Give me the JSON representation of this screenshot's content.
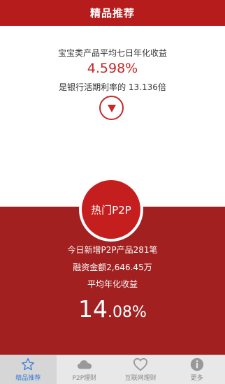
{
  "header": {
    "title": "精品推荐"
  },
  "baobao": {
    "label": "宝宝类产品平均七日年化收益",
    "rate": "4.598%",
    "compare": "是银行活期利率的 13.136倍"
  },
  "hot_p2p": {
    "badge": "热门P2P",
    "new_products": "今日新增P2P产品281笔",
    "financing": "融资金额2,646.45万",
    "avg_label": "平均年化收益",
    "rate_big": "14",
    "rate_small": ".08%"
  },
  "tabs": [
    {
      "label": "精品推荐",
      "icon": "star-icon",
      "active": true
    },
    {
      "label": "P2P理财",
      "icon": "cloud-icon",
      "active": false
    },
    {
      "label": "互联网理财",
      "icon": "heart-icon",
      "active": false
    },
    {
      "label": "更多",
      "icon": "info-icon",
      "active": false
    }
  ],
  "colors": {
    "header_red": "#b71c1c",
    "section_red": "#a32020",
    "accent_red": "#c62828",
    "active_tab_blue": "#3a7bd5"
  }
}
